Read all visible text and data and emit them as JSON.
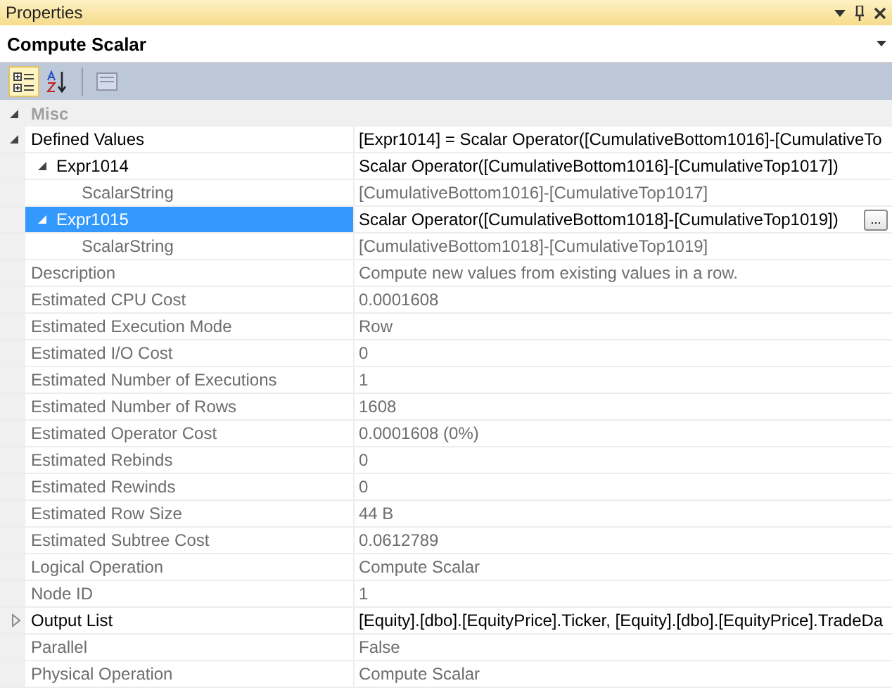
{
  "panel": {
    "title": "Properties"
  },
  "object_selector": {
    "value": "Compute Scalar"
  },
  "toolbar": [
    {
      "kind": "categorized",
      "selected": true
    },
    {
      "kind": "alphabetical",
      "selected": false
    },
    {
      "kind": "pages",
      "disabled": true
    }
  ],
  "categories": [
    {
      "name": "Misc",
      "expanded": true,
      "properties": [
        {
          "name": "Defined Values",
          "value": "[Expr1014] = Scalar Operator([CumulativeBottom1016]-[CumulativeTo",
          "readonly": false,
          "selected": false,
          "expanded": true,
          "children": [
            {
              "name": "Expr1014",
              "value": "Scalar Operator([CumulativeBottom1016]-[CumulativeTop1017])",
              "readonly": false,
              "selected": false,
              "expanded": true,
              "children": [
                {
                  "name": "ScalarString",
                  "value": "[CumulativeBottom1016]-[CumulativeTop1017]",
                  "readonly": true,
                  "selected": false
                }
              ]
            },
            {
              "name": "Expr1015",
              "value": "Scalar Operator([CumulativeBottom1018]-[CumulativeTop1019])",
              "readonly": false,
              "selected": true,
              "expanded": true,
              "button": "...",
              "children": [
                {
                  "name": "ScalarString",
                  "value": "[CumulativeBottom1018]-[CumulativeTop1019]",
                  "readonly": true,
                  "selected": false
                }
              ]
            }
          ]
        },
        {
          "name": "Description",
          "value": "Compute new values from existing values in a row.",
          "readonly": true,
          "selected": false
        },
        {
          "name": "Estimated CPU Cost",
          "value": "0.0001608",
          "readonly": true,
          "selected": false
        },
        {
          "name": "Estimated Execution Mode",
          "value": "Row",
          "readonly": true,
          "selected": false
        },
        {
          "name": "Estimated I/O Cost",
          "value": "0",
          "readonly": true,
          "selected": false
        },
        {
          "name": "Estimated Number of Executions",
          "value": "1",
          "readonly": true,
          "selected": false
        },
        {
          "name": "Estimated Number of Rows",
          "value": "1608",
          "readonly": true,
          "selected": false
        },
        {
          "name": "Estimated Operator Cost",
          "value": "0.0001608 (0%)",
          "readonly": true,
          "selected": false
        },
        {
          "name": "Estimated Rebinds",
          "value": "0",
          "readonly": true,
          "selected": false
        },
        {
          "name": "Estimated Rewinds",
          "value": "0",
          "readonly": true,
          "selected": false
        },
        {
          "name": "Estimated Row Size",
          "value": "44 B",
          "readonly": true,
          "selected": false
        },
        {
          "name": "Estimated Subtree Cost",
          "value": "0.0612789",
          "readonly": true,
          "selected": false
        },
        {
          "name": "Logical Operation",
          "value": "Compute Scalar",
          "readonly": true,
          "selected": false
        },
        {
          "name": "Node ID",
          "value": "1",
          "readonly": true,
          "selected": false
        },
        {
          "name": "Output List",
          "value": "[Equity].[dbo].[EquityPrice].Ticker, [Equity].[dbo].[EquityPrice].TradeDa",
          "readonly": false,
          "selected": false,
          "expanded": false
        },
        {
          "name": "Parallel",
          "value": "False",
          "readonly": true,
          "selected": false
        },
        {
          "name": "Physical Operation",
          "value": "Compute Scalar",
          "readonly": true,
          "selected": false
        }
      ]
    }
  ]
}
